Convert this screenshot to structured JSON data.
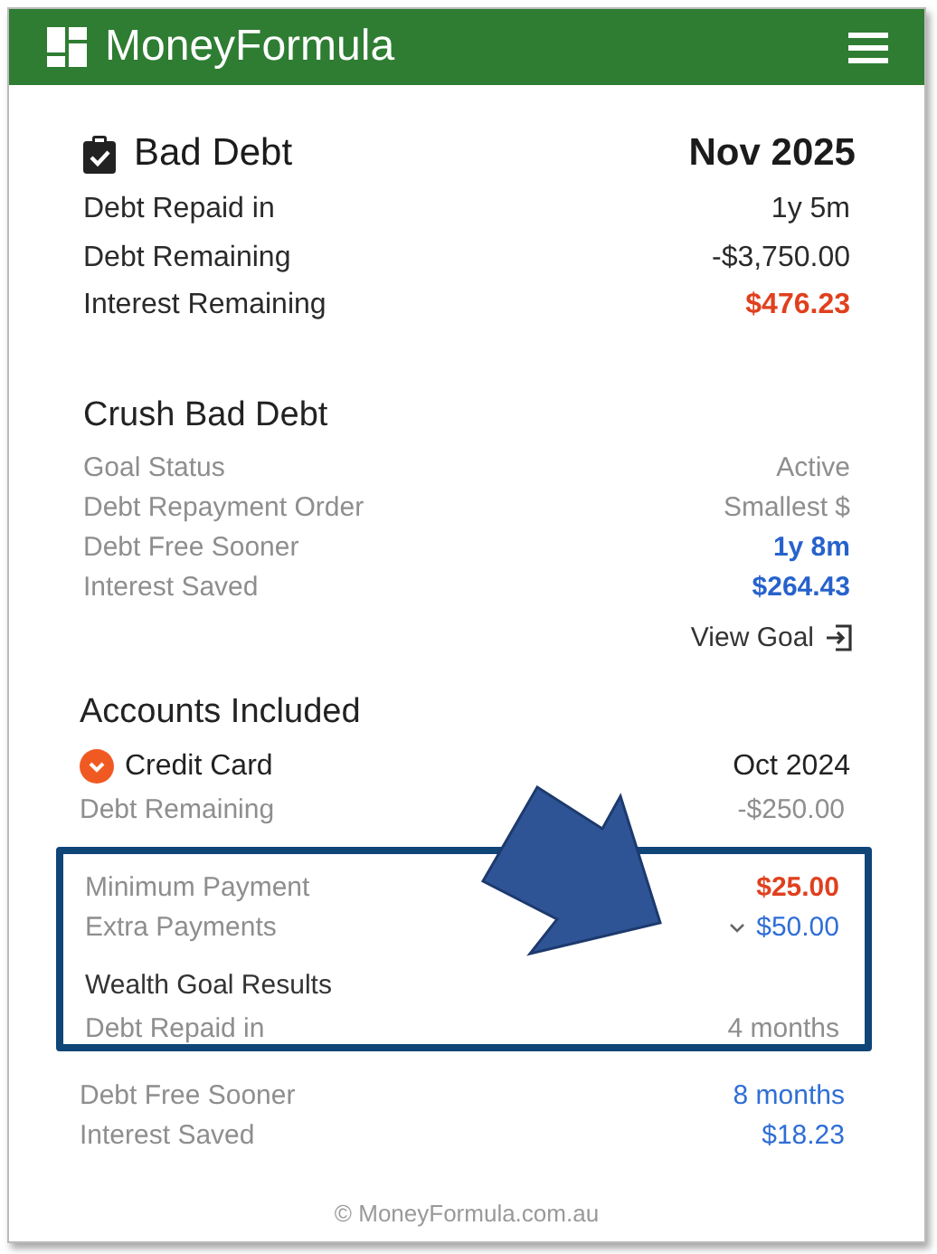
{
  "header": {
    "brand": "MoneyFormula"
  },
  "summary": {
    "title": "Bad Debt",
    "date": "Nov 2025",
    "rows": [
      {
        "label": "Debt Repaid in",
        "value": "1y 5m",
        "kind": "plain"
      },
      {
        "label": "Debt Remaining",
        "value": "-$3,750.00",
        "kind": "plain"
      },
      {
        "label": "Interest Remaining",
        "value": "$476.23",
        "kind": "alert"
      }
    ]
  },
  "goal": {
    "title": "Crush Bad Debt",
    "rows": [
      {
        "label": "Goal Status",
        "value": "Active",
        "kind": "muted"
      },
      {
        "label": "Debt Repayment Order",
        "value": "Smallest $",
        "kind": "muted"
      },
      {
        "label": "Debt Free Sooner",
        "value": "1y 8m",
        "kind": "gain"
      },
      {
        "label": "Interest Saved",
        "value": "$264.43",
        "kind": "gain"
      }
    ],
    "link": "View Goal"
  },
  "accounts": {
    "title": "Accounts Included",
    "items": [
      {
        "name": "Credit Card",
        "date": "Oct 2024",
        "expanded": true,
        "rows": [
          {
            "label": "Debt Remaining",
            "value": "-$250.00",
            "kind": "muted"
          }
        ],
        "highlight": {
          "rows": [
            {
              "label": "Minimum Payment",
              "value": "$25.00",
              "kind": "alert",
              "dropdown": false
            },
            {
              "label": "Extra Payments",
              "value": "$50.00",
              "kind": "link",
              "dropdown": true
            }
          ],
          "results_title": "Wealth Goal Results",
          "results_rows": [
            {
              "label": "Debt Repaid in",
              "value": "4 months",
              "kind": "muted"
            }
          ]
        },
        "more_results": [
          {
            "label": "Debt Free Sooner",
            "value": "8 months",
            "kind": "link"
          },
          {
            "label": "Interest Saved",
            "value": "$18.23",
            "kind": "link"
          }
        ]
      }
    ]
  },
  "footer": "© MoneyFormula.com.au"
}
